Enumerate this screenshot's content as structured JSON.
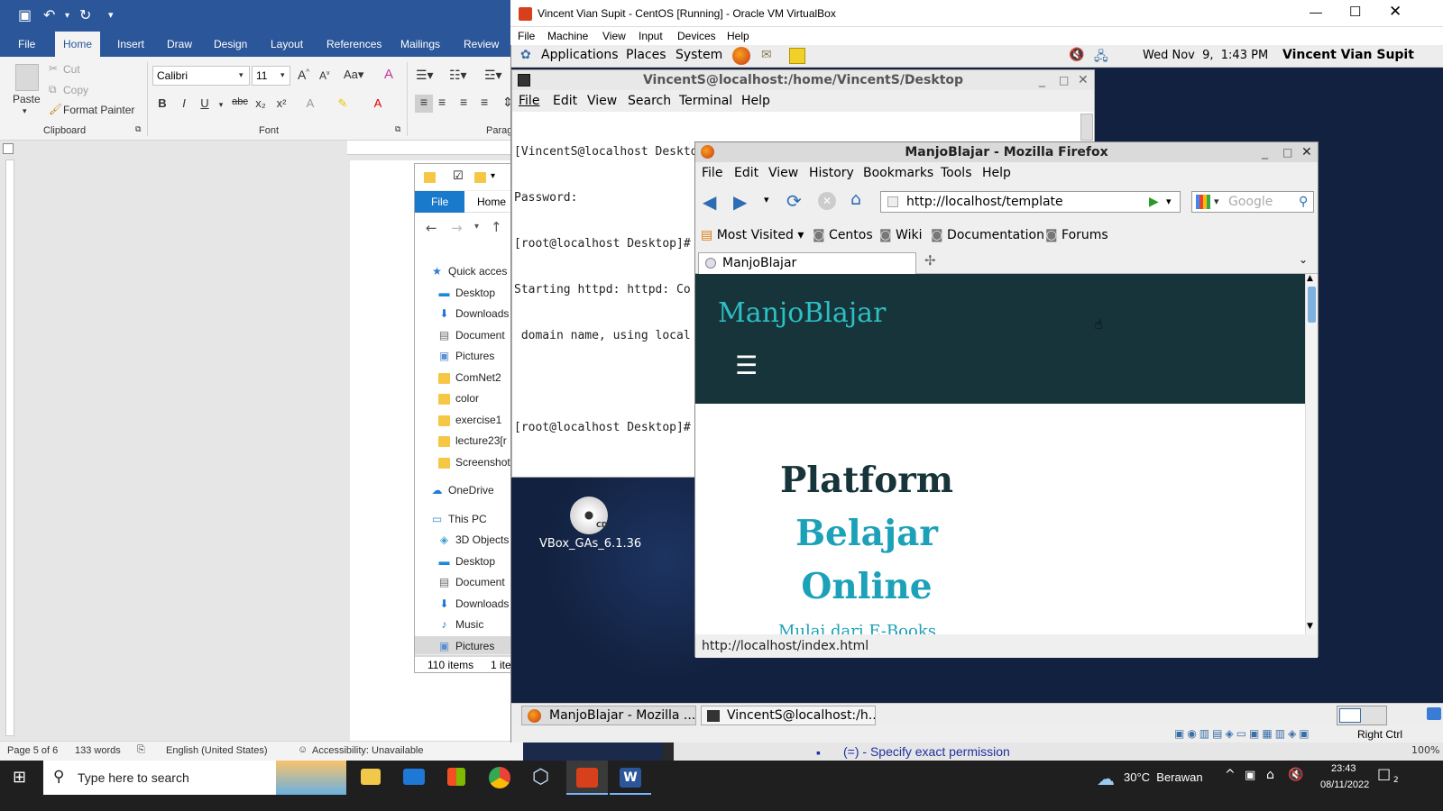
{
  "word": {
    "tabs": [
      "File",
      "Home",
      "Insert",
      "Draw",
      "Design",
      "Layout",
      "References",
      "Mailings",
      "Review"
    ],
    "clipboard": {
      "paste": "Paste",
      "cut": "Cut",
      "copy": "Copy",
      "format_painter": "Format Painter",
      "group": "Clipboard"
    },
    "font": {
      "name": "Calibri",
      "size": "11",
      "group": "Font"
    },
    "paragraph_group": "Parag",
    "status": {
      "page": "Page 5 of 6",
      "words": "133 words",
      "language": "English (United States)",
      "accessibility": "Accessibility: Unavailable"
    },
    "zoom": "100%",
    "behind_text": "(=) - Specify exact permission"
  },
  "explorer": {
    "ribbon_tabs": [
      "File",
      "Home"
    ],
    "items": [
      "Quick acces",
      "Desktop",
      "Downloads",
      "Document",
      "Pictures",
      "ComNet2",
      "color",
      "exercise1",
      "lecture23[r",
      "Screenshot",
      "OneDrive",
      "This PC",
      "3D Objects",
      "Desktop",
      "Document",
      "Downloads",
      "Music",
      "Pictures"
    ],
    "status_count": "110 items",
    "status_sel": "1 ite"
  },
  "vbox": {
    "title": "Vincent Vian Supit - CentOS [Running] - Oracle VM VirtualBox",
    "menu": [
      "File",
      "Machine",
      "View",
      "Input",
      "Devices",
      "Help"
    ],
    "host_key": "Right Ctrl"
  },
  "gnome": {
    "menus": [
      "Applications",
      "Places",
      "System"
    ],
    "clock": "Wed Nov  9,  1:43 PM",
    "user": "Vincent Vian Supit",
    "tasks": [
      "ManjoBlajar - Mozilla ...",
      "VincentS@localhost:/h..."
    ],
    "desktop_icon": "VBox_GAs_6.1.36",
    "desktop_icon_badge": "CD"
  },
  "terminal": {
    "title": "VincentS@localhost:/home/VincentS/Desktop",
    "menu": [
      "File",
      "Edit",
      "View",
      "Search",
      "Terminal",
      "Help"
    ],
    "lines": [
      "[VincentS@localhost Desktop]$ su",
      "Password:",
      "[root@localhost Desktop]# ",
      "Starting httpd: httpd: Co",
      " domain name, using local",
      "",
      "[root@localhost Desktop]# "
    ]
  },
  "firefox": {
    "title": "ManjoBlajar - Mozilla Firefox",
    "menu": [
      "File",
      "Edit",
      "View",
      "History",
      "Bookmarks",
      "Tools",
      "Help"
    ],
    "url": "http://localhost/template",
    "search_placeholder": "Google",
    "bookmarks": [
      "Most Visited",
      "Centos",
      "Wiki",
      "Documentation",
      "Forums"
    ],
    "tab": "ManjoBlajar",
    "status": "http://localhost/index.html",
    "page": {
      "brand": "ManjoBlajar",
      "headline1": "Platform",
      "headline2": "Belajar",
      "headline3": "Online",
      "sub": "Mulai dari E-Books"
    }
  },
  "taskbar": {
    "search": "Type here to search",
    "weather": "30°C  Berawan",
    "time": "23:43",
    "date": "08/11/2022",
    "notifications": "2"
  }
}
